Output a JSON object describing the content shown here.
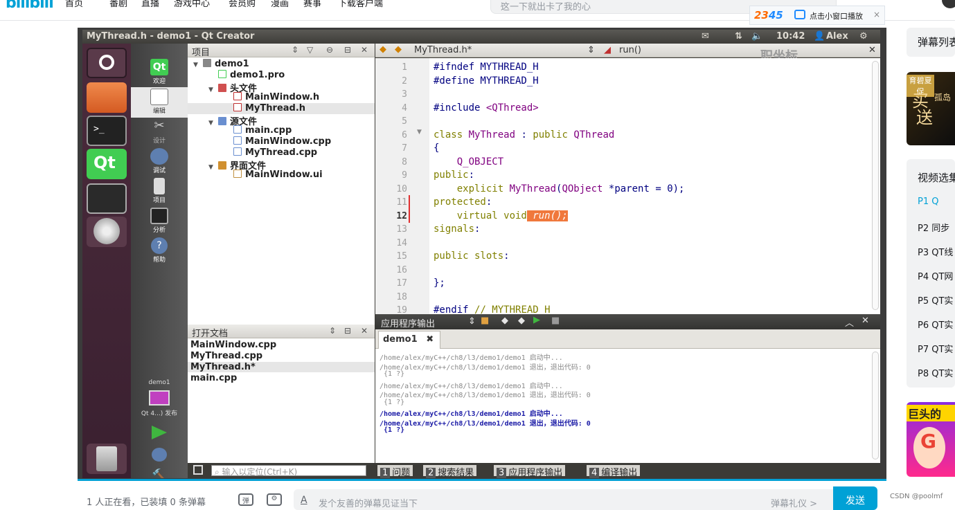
{
  "site": {
    "logo": "bilibili",
    "nav": [
      "首页",
      "番剧",
      "直播",
      "游戏中心",
      "会员购",
      "漫画",
      "赛事",
      "下载客户端"
    ],
    "search_placeholder": "这一下就出卡了我的心"
  },
  "popup": {
    "brand_a": "23",
    "brand_b": "45",
    "label": "点击小窗口播放",
    "close": "×"
  },
  "qt": {
    "window_title": "MyThread.h - demo1 - Qt Creator",
    "tray": {
      "time": "10:42",
      "user": "Alex"
    },
    "modes": [
      {
        "label": "欢迎"
      },
      {
        "label": "编辑"
      },
      {
        "label": "设计"
      },
      {
        "label": "调试"
      },
      {
        "label": "项目"
      },
      {
        "label": "分析"
      },
      {
        "label": "帮助"
      }
    ],
    "run_target": {
      "name": "demo1",
      "label": "Qt 4...) 发布"
    },
    "project_pane": {
      "title": "项目",
      "tree": [
        {
          "label": "demo1",
          "indent": 0,
          "arrow": "▼"
        },
        {
          "label": "demo1.pro",
          "indent": 1,
          "arrow": ""
        },
        {
          "label": "头文件",
          "indent": 1,
          "arrow": "▼"
        },
        {
          "label": "MainWindow.h",
          "indent": 2,
          "arrow": ""
        },
        {
          "label": "MyThread.h",
          "indent": 2,
          "arrow": "",
          "selected": true
        },
        {
          "label": "源文件",
          "indent": 1,
          "arrow": "▼"
        },
        {
          "label": "main.cpp",
          "indent": 2,
          "arrow": ""
        },
        {
          "label": "MainWindow.cpp",
          "indent": 2,
          "arrow": ""
        },
        {
          "label": "MyThread.cpp",
          "indent": 2,
          "arrow": ""
        },
        {
          "label": "界面文件",
          "indent": 1,
          "arrow": "▼"
        },
        {
          "label": "MainWindow.ui",
          "indent": 2,
          "arrow": ""
        }
      ]
    },
    "open_docs": {
      "title": "打开文档",
      "items": [
        "MainWindow.cpp",
        "MyThread.cpp",
        "MyThread.h*",
        "main.cpp"
      ]
    },
    "editor": {
      "file_tab": "MyThread.h*",
      "symbol": "run()",
      "watermark": "职坐标",
      "lines": [
        {
          "n": "1",
          "segs": [
            [
              "pp",
              "#ifndef MYTHREAD_H"
            ]
          ]
        },
        {
          "n": "2",
          "segs": [
            [
              "pp",
              "#define MYTHREAD_H"
            ]
          ]
        },
        {
          "n": "3",
          "segs": []
        },
        {
          "n": "4",
          "segs": [
            [
              "pp",
              "#include "
            ],
            [
              "ty",
              "<QThread>"
            ]
          ]
        },
        {
          "n": "5",
          "segs": []
        },
        {
          "n": "6",
          "segs": [
            [
              "kw",
              "class "
            ],
            [
              "ty",
              "MyThread"
            ],
            [
              "pp",
              " : "
            ],
            [
              "kw",
              "public "
            ],
            [
              "ty",
              "QThread"
            ]
          ]
        },
        {
          "n": "7",
          "segs": [
            [
              "pp",
              "{"
            ]
          ]
        },
        {
          "n": "8",
          "segs": [
            [
              "ty",
              "    Q_OBJECT"
            ]
          ]
        },
        {
          "n": "9",
          "segs": [
            [
              "kw",
              "public"
            ],
            [
              "pp",
              ":"
            ]
          ]
        },
        {
          "n": "10",
          "segs": [
            [
              "kw",
              "    explicit "
            ],
            [
              "ty",
              "MyThread"
            ],
            [
              "pp",
              "("
            ],
            [
              "ty",
              "QObject"
            ],
            [
              "pp",
              " *parent = "
            ],
            [
              "num",
              "0"
            ],
            [
              "pp",
              ");"
            ]
          ]
        },
        {
          "n": "11",
          "segs": [
            [
              "kw",
              "protected"
            ],
            [
              "pp",
              ":"
            ]
          ]
        },
        {
          "n": "12",
          "segs": [
            [
              "kw",
              "    virtual void"
            ],
            [
              "hl",
              " run();"
            ]
          ],
          "current": true
        },
        {
          "n": "13",
          "segs": [
            [
              "kw",
              "signals"
            ],
            [
              "pp",
              ":"
            ]
          ]
        },
        {
          "n": "14",
          "segs": []
        },
        {
          "n": "15",
          "segs": [
            [
              "kw",
              "public slots"
            ],
            [
              "pp",
              ":"
            ]
          ]
        },
        {
          "n": "16",
          "segs": []
        },
        {
          "n": "17",
          "segs": [
            [
              "pp",
              "};"
            ]
          ]
        },
        {
          "n": "18",
          "segs": []
        },
        {
          "n": "19",
          "segs": [
            [
              "pp",
              "#endif "
            ],
            [
              "kw",
              "// MYTHREAD_H"
            ]
          ]
        }
      ]
    },
    "output": {
      "title": "应用程序输出",
      "tab": "demo1",
      "lines": [
        "/home/alex/myC++/ch8/l3/demo1/demo1 启动中...",
        "/home/alex/myC++/ch8/l3/demo1/demo1 退出，退出代码: 0",
        " {1 ?}",
        "/home/alex/myC++/ch8/l3/demo1/demo1 启动中...",
        "/home/alex/myC++/ch8/l3/demo1/demo1 退出，退出代码: 0",
        " {1 ?}",
        "/home/alex/myC++/ch8/l3/demo1/demo1 启动中...",
        "/home/alex/myC++/ch8/l3/demo1/demo1 退出，退出代码: 0",
        " {1 ?}"
      ]
    },
    "status": {
      "locator_placeholder": "输入以定位(Ctrl+K)",
      "tabs": [
        {
          "n": "1",
          "label": "问题"
        },
        {
          "n": "2",
          "label": "搜索结果"
        },
        {
          "n": "3",
          "label": "应用程序输出"
        },
        {
          "n": "4",
          "label": "编译输出"
        }
      ]
    }
  },
  "danmaku": {
    "watchers": "1 人正在看，已装填 0 条弹幕",
    "input_placeholder": "发个友善的弹幕见证当下",
    "etiquette": "弹幕礼仪 >",
    "send": "发送",
    "icon_a": "A"
  },
  "sidebar": {
    "danmaku_list": "弹幕列表",
    "ad1": {
      "tag": "育碧夏促",
      "a": "买",
      "b": "送",
      "c": "孤岛"
    },
    "playlist_title": "视频选集",
    "items": [
      {
        "label": "P1  Q",
        "active": true
      },
      {
        "label": "P2  同步"
      },
      {
        "label": "P3  QT线"
      },
      {
        "label": "P4  QT网"
      },
      {
        "label": "P5  QT实"
      },
      {
        "label": "P6  QT实"
      },
      {
        "label": "P7  QT实"
      },
      {
        "label": "P8  QT实"
      }
    ],
    "ad2_title": "巨头的"
  },
  "footer": {
    "csdn": "CSDN @poolmf"
  }
}
